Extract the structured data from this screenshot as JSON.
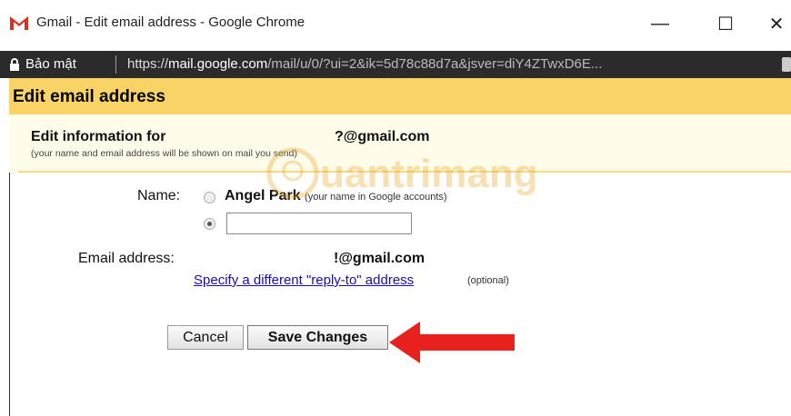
{
  "window": {
    "title": "Gmail - Edit email address - Google Chrome",
    "minimize": "—",
    "maximize": "☐",
    "close": "✕"
  },
  "addressbar": {
    "security_label": "Bảo mật",
    "url_scheme": "https://",
    "url_host": "mail.google.com",
    "url_path": "/mail/u/0/?ui=2&ik=5d78c88d7a&jsver=diY4ZTwxD6E..."
  },
  "page": {
    "title": "Edit email address",
    "info_prefix": "Edit information for",
    "info_email_suffix": "?@gmail.com",
    "info_note": "(your name and email address will be shown on mail you send)",
    "name_label": "Name:",
    "name_value": "Angel Park",
    "name_note": "(your name in Google accounts)",
    "name_input_value": "",
    "email_label": "Email address:",
    "email_value": "!@gmail.com",
    "replyto_link": "Specify a different \"reply-to\" address",
    "optional_note": "(optional)",
    "cancel_label": "Cancel",
    "save_label": "Save Changes"
  },
  "watermark": {
    "text": "uantrimang"
  },
  "colors": {
    "header_bg": "#f9d365",
    "info_bg": "#fffcea",
    "arrow": "#e8211f",
    "link": "#1a0dab"
  }
}
